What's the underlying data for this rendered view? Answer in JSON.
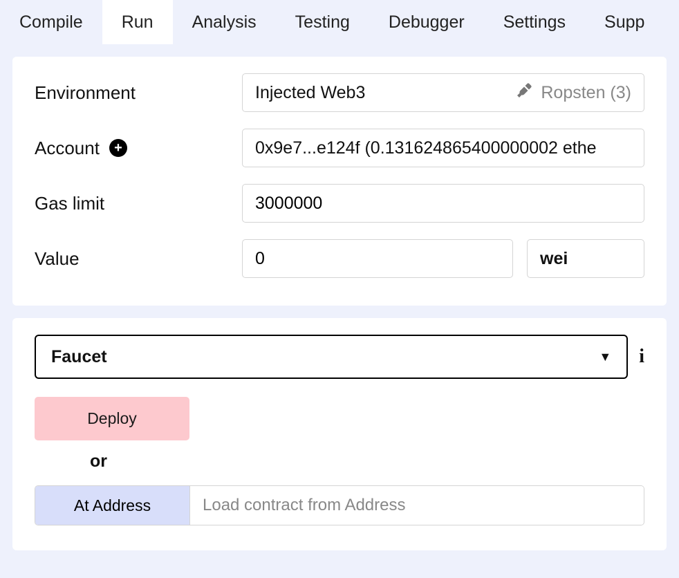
{
  "tabs": {
    "compile": "Compile",
    "run": "Run",
    "analysis": "Analysis",
    "testing": "Testing",
    "debugger": "Debugger",
    "settings": "Settings",
    "support": "Supp"
  },
  "env": {
    "label": "Environment",
    "selected": "Injected Web3",
    "network": "Ropsten (3)"
  },
  "account": {
    "label": "Account",
    "value": "0x9e7...e124f (0.131624865400000002 ethe"
  },
  "gas": {
    "label": "Gas limit",
    "value": "3000000"
  },
  "value": {
    "label": "Value",
    "amount": "0",
    "unit": "wei"
  },
  "contract": {
    "selected": "Faucet"
  },
  "actions": {
    "deploy": "Deploy",
    "or": "or",
    "at_address": "At Address",
    "addr_placeholder": "Load contract from Address"
  }
}
